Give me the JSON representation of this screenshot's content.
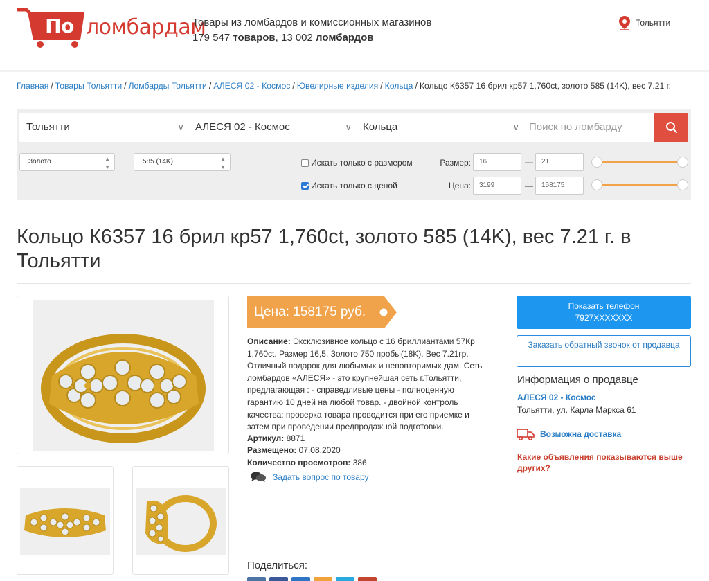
{
  "header": {
    "logo_part1": "По",
    "logo_part2": "ломбардам",
    "tagline": "Товары из ломбардов и комиссионных магазинов",
    "goods_count": "179 547",
    "goods_word": "товаров",
    "pawns_count": "13 002",
    "pawns_word": "ломбардов",
    "city": "Тольятти"
  },
  "breadcrumb": [
    {
      "label": "Главная",
      "link": true
    },
    {
      "label": "Товары Тольятти",
      "link": true
    },
    {
      "label": "Ломбарды Тольятти",
      "link": true
    },
    {
      "label": "АЛЕСЯ 02 - Космос",
      "link": true
    },
    {
      "label": "Ювелирные изделия",
      "link": true
    },
    {
      "label": "Кольца",
      "link": true
    },
    {
      "label": "Кольцо К6357 16 брил кр57 1,760ct, золото 585 (14K), вес 7.21 г.",
      "link": false
    }
  ],
  "search": {
    "city_select": "Тольятти",
    "pawn_select": "АЛЕСЯ 02 - Космос",
    "category_select": "Кольца",
    "placeholder": "Поиск по ломбарду",
    "metal_select": "Золото",
    "probe_select": "585 (14K)",
    "only_size_label": "Искать только с размером",
    "only_size_checked": false,
    "only_price_label": "Искать только с ценой",
    "only_price_checked": true,
    "size_label": "Размер:",
    "size_from": "16",
    "size_to": "21",
    "price_label": "Цена:",
    "price_from": "3199",
    "price_to": "158175",
    "dash": "—"
  },
  "product": {
    "title": "Кольцо К6357 16 брил кр57 1,760ct, золото 585 (14K), вес 7.21 г. в Тольятти",
    "price": "Цена: 158175 руб.",
    "description_label": "Описание:",
    "description": "Эксклюзивное кольцо с 16 бриллиантами 57Кр 1,760ct. Размер 16,5. Золото 750 пробы(18K). Вес 7.21гр. Отличный подарок для любымых и неповторимых дам. Сеть ломбардов «АЛЕСЯ» - это крупнейшая сеть г.Тольятти, предлагающая : - справедливые цены - полноценную гарантию 10 дней на любой товар. - двойной контроль качества: проверка товара проводится при его приемке и затем при проведении предпродажной подготовки.",
    "article_label": "Артикул:",
    "article": "8871",
    "posted_label": "Размещено:",
    "posted": "07.08.2020",
    "views_label": "Количество просмотров:",
    "views": "386",
    "ask_label": "Задать вопрос по товару",
    "share_label": "Поделиться:"
  },
  "seller": {
    "show_phone_label": "Показать телефон",
    "phone_masked": "7927XXXXXXX",
    "callback_label": "Заказать обратный звонок от продавца",
    "info_heading": "Информация о продавце",
    "name": "АЛЕСЯ 02 - Космос",
    "address": "Тольятти, ул. Карла Маркса 61",
    "delivery_label": "Возможна доставка",
    "ads_link": "Какие объявления показываются выше других?"
  },
  "colors": {
    "brand_red": "#d43a2f",
    "price_orange": "#f0a34a",
    "button_blue": "#1d96f0",
    "link_blue": "#2a7dc4"
  }
}
